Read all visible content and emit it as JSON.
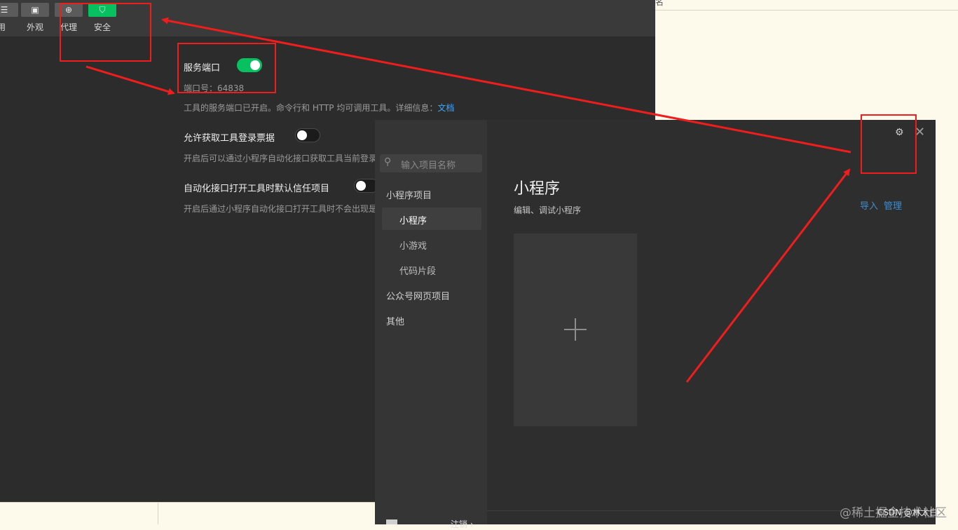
{
  "toolbar": {
    "items": [
      {
        "icon": "menu-icon",
        "label": "通用"
      },
      {
        "icon": "appearance-icon",
        "label": "外观"
      },
      {
        "icon": "globe-icon",
        "label": "代理"
      },
      {
        "icon": "shield-icon",
        "label": "安全"
      }
    ],
    "visible_first_label": "用",
    "active_color": "#07c160"
  },
  "settings": {
    "service_port": {
      "title": "服务端口",
      "enabled": true,
      "port_label": "端口号：64838",
      "desc": "工具的服务端口已开启。命令行和 HTTP 均可调用工具。详细信息：",
      "doc_link": "文档"
    },
    "login_ticket": {
      "title": "允许获取工具登录票据",
      "enabled": false,
      "desc": "开启后可以通过小程序自动化接口获取工具当前登录"
    },
    "auto_trust": {
      "title": "自动化接口打开工具时默认信任项目",
      "enabled": false,
      "desc": "开启后通过小程序自动化接口打开工具时不会出现是"
    }
  },
  "project_window": {
    "search_placeholder": "输入项目名称",
    "nav": {
      "mini_program_projects": "小程序项目",
      "mini_program": "小程序",
      "mini_game": "小游戏",
      "code_snippet": "代码片段",
      "official_account_web": "公众号网页项目",
      "other": "其他"
    },
    "main": {
      "title": "小程序",
      "subtitle": "编辑、调试小程序",
      "import": "导入",
      "manage": "管理"
    },
    "bottom_text": "注销 ›"
  },
  "top_strip_char": "名",
  "watermark": "@稀土掘金技术社区",
  "watermark_sub": "CSDN @林太白",
  "annotation_color": "#f01d1d"
}
